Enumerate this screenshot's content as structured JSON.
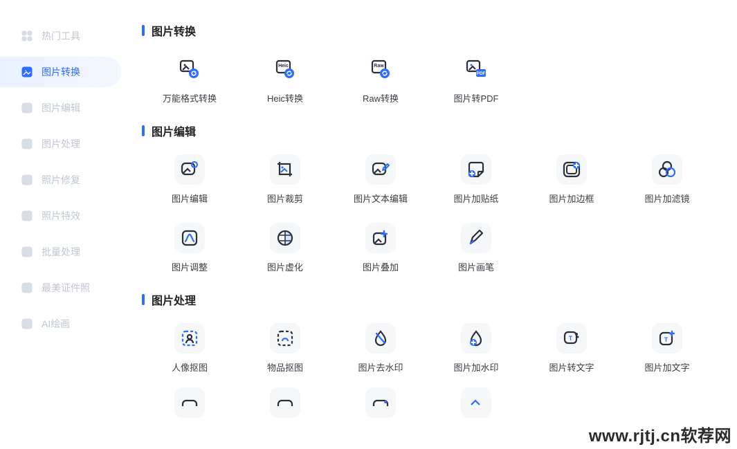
{
  "sidebar": {
    "items": [
      {
        "label": "热门工具"
      },
      {
        "label": "图片转换"
      },
      {
        "label": "图片编辑"
      },
      {
        "label": "图片处理"
      },
      {
        "label": "照片修复"
      },
      {
        "label": "照片特效"
      },
      {
        "label": "批量处理"
      },
      {
        "label": "最美证件照"
      },
      {
        "label": "AI绘画"
      }
    ],
    "active_index": 1
  },
  "sections": [
    {
      "title": "图片转换",
      "rows": [
        [
          {
            "label": "万能格式转换",
            "icon": "convert-icon"
          },
          {
            "label": "Heic转换",
            "icon": "heic-icon"
          },
          {
            "label": "Raw转换",
            "icon": "raw-icon"
          },
          {
            "label": "图片转PDF",
            "icon": "pdf-icon"
          }
        ]
      ]
    },
    {
      "title": "图片编辑",
      "rows": [
        [
          {
            "label": "图片编辑",
            "icon": "edit-gear-icon"
          },
          {
            "label": "图片裁剪",
            "icon": "crop-icon"
          },
          {
            "label": "图片文本编辑",
            "icon": "text-edit-icon"
          },
          {
            "label": "图片加贴纸",
            "icon": "sticker-icon"
          },
          {
            "label": "图片加边框",
            "icon": "border-icon"
          },
          {
            "label": "图片加滤镜",
            "icon": "filter-icon"
          }
        ],
        [
          {
            "label": "图片调整",
            "icon": "adjust-icon"
          },
          {
            "label": "图片虚化",
            "icon": "blur-icon"
          },
          {
            "label": "图片叠加",
            "icon": "overlay-icon"
          },
          {
            "label": "图片画笔",
            "icon": "pen-icon"
          }
        ]
      ]
    },
    {
      "title": "图片处理",
      "rows": [
        [
          {
            "label": "人像抠图",
            "icon": "person-cutout-icon"
          },
          {
            "label": "物品抠图",
            "icon": "object-cutout-icon"
          },
          {
            "label": "图片去水印",
            "icon": "remove-watermark-icon"
          },
          {
            "label": "图片加水印",
            "icon": "add-watermark-icon"
          },
          {
            "label": "图片转文字",
            "icon": "ocr-icon"
          },
          {
            "label": "图片加文字",
            "icon": "add-text-icon"
          }
        ]
      ]
    }
  ],
  "watermark": "www.rjtj.cn软荐网",
  "colors": {
    "accent": "#2c6eff",
    "icon_dark": "#2a2f3a",
    "sidebar_muted": "#bfc6d4"
  }
}
